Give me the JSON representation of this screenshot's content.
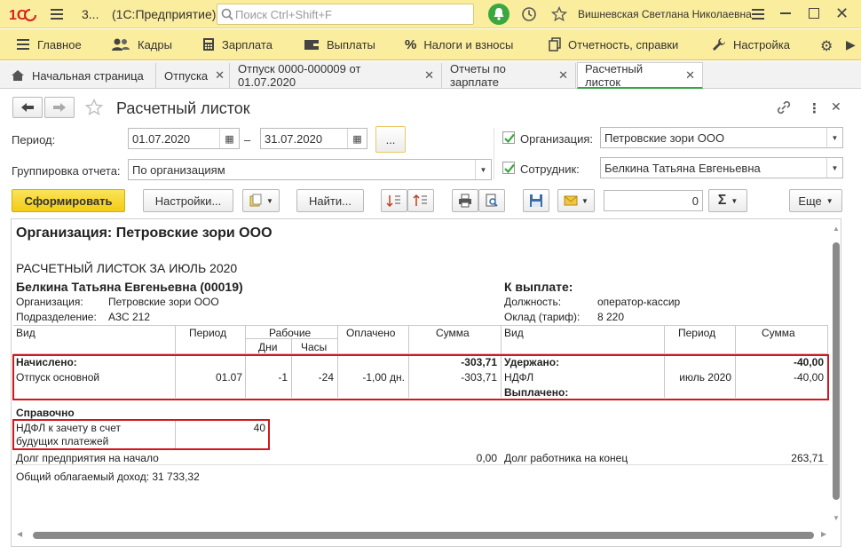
{
  "titlebar": {
    "app_number": "3...",
    "app_name": "(1С:Предприятие)",
    "search_placeholder": "Поиск Ctrl+Shift+F",
    "user": "Вишневская Светлана Николаевна"
  },
  "sections": [
    {
      "label": "Главное",
      "icon": "menu-icon"
    },
    {
      "label": "Кадры",
      "icon": "people-icon"
    },
    {
      "label": "Зарплата",
      "icon": "calculator-icon"
    },
    {
      "label": "Выплаты",
      "icon": "wallet-icon"
    },
    {
      "label": "Налоги и взносы",
      "icon": "percent-icon"
    },
    {
      "label": "Отчетность, справки",
      "icon": "documents-icon"
    },
    {
      "label": "Настройка",
      "icon": "wrench-icon"
    }
  ],
  "tabs": [
    {
      "label": "Начальная страница"
    },
    {
      "label": "Отпуска"
    },
    {
      "label": "Отпуск 0000-000009 от 01.07.2020"
    },
    {
      "label": "Отчеты по зарплате"
    },
    {
      "label": "Расчетный листок"
    }
  ],
  "form": {
    "title": "Расчетный листок",
    "period_label": "Период:",
    "period_from": "01.07.2020",
    "period_dash": "–",
    "period_to": "31.07.2020",
    "period_more": "...",
    "grouping_label": "Группировка отчета:",
    "grouping_value": "По организациям",
    "org_label": "Организация:",
    "org_value": "Петровские зори ООО",
    "org_checked": true,
    "employee_label": "Сотрудник:",
    "employee_value": "Белкина Татьяна Евгеньевна",
    "employee_checked": true
  },
  "toolbar": {
    "generate": "Сформировать",
    "settings": "Настройки...",
    "find": "Найти...",
    "sum_value": "0",
    "more": "Еще"
  },
  "report": {
    "org_heading": "Организация: Петровские зори ООО",
    "title": "РАСЧЕТНЫЙ ЛИСТОК ЗА ИЮЛЬ 2020",
    "employee": "Белкина Татьяна Евгеньевна (00019)",
    "org_label": "Организация:",
    "org_value": "Петровские зори ООО",
    "dept_label": "Подразделение:",
    "dept_value": "АЗС 212",
    "to_pay_label": "К выплате:",
    "position_label": "Должность:",
    "position_value": "оператор-кассир",
    "salary_label": "Оклад (тариф):",
    "salary_value": "8 220",
    "headers": {
      "vid": "Вид",
      "period": "Период",
      "working": "Рабочие",
      "days": "Дни",
      "hours": "Часы",
      "paid": "Оплачено",
      "sum": "Сумма",
      "vid2": "Вид",
      "period2": "Период",
      "sum2": "Сумма"
    },
    "accrued_label": "Начислено:",
    "accrued_total": "-303,71",
    "accrual_row": {
      "vid": "Отпуск основной",
      "period": "01.07",
      "days": "-1",
      "hours": "-24",
      "paid": "-1,00 дн.",
      "sum": "-303,71"
    },
    "withheld_label": "Удержано:",
    "withheld_total": "-40,00",
    "withheld_row": {
      "vid": "НДФЛ",
      "period": "июль 2020",
      "sum": "-40,00"
    },
    "paid_out_label": "Выплачено:",
    "reference_label": "Справочно",
    "ndfl_offset_line1": "НДФЛ к зачету в счет",
    "ndfl_offset_line2": "будущих платежей",
    "ndfl_offset_value": "40",
    "company_debt_label": "Долг предприятия на начало",
    "company_debt_value": "0,00",
    "employee_debt_label": "Долг работника на конец",
    "employee_debt_value": "263,71",
    "taxable_income": "Общий облагаемый доход: 31 733,32"
  }
}
